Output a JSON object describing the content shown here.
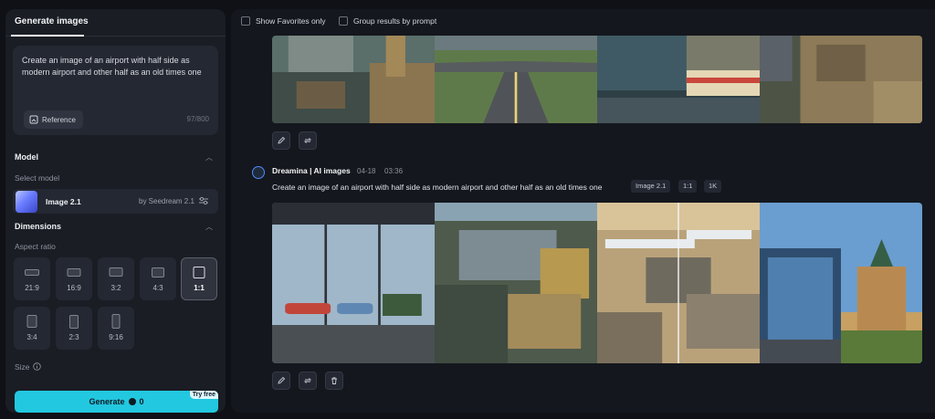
{
  "panel": {
    "tab_label": "Generate images",
    "prompt": "Create an image of an airport with half side as modern airport and other half as an old times one",
    "reference_label": "Reference",
    "char_count": "97/800"
  },
  "model": {
    "section_title": "Model",
    "select_label": "Select model",
    "name": "Image 2.1",
    "by": "by Seedream 2.1"
  },
  "dimensions": {
    "section_title": "Dimensions",
    "aspect_label": "Aspect ratio",
    "ratios": [
      "21:9",
      "16:9",
      "3:2",
      "4:3",
      "1:1",
      "3:4",
      "2:3",
      "9:16"
    ],
    "selected": "1:1",
    "size_label": "Size"
  },
  "generate": {
    "label": "Generate",
    "cost": "0",
    "badge": "Try free",
    "accent": "#22c8e0"
  },
  "filters": {
    "favorites": "Show Favorites only",
    "group": "Group results by prompt"
  },
  "result": {
    "author": "Dreamina | AI images",
    "date": "04-18",
    "time": "03:36",
    "prompt": "Create an image of an airport with half side as modern airport and other half as an old times one",
    "tags": [
      "Image 2.1",
      "1:1",
      "1K"
    ]
  }
}
